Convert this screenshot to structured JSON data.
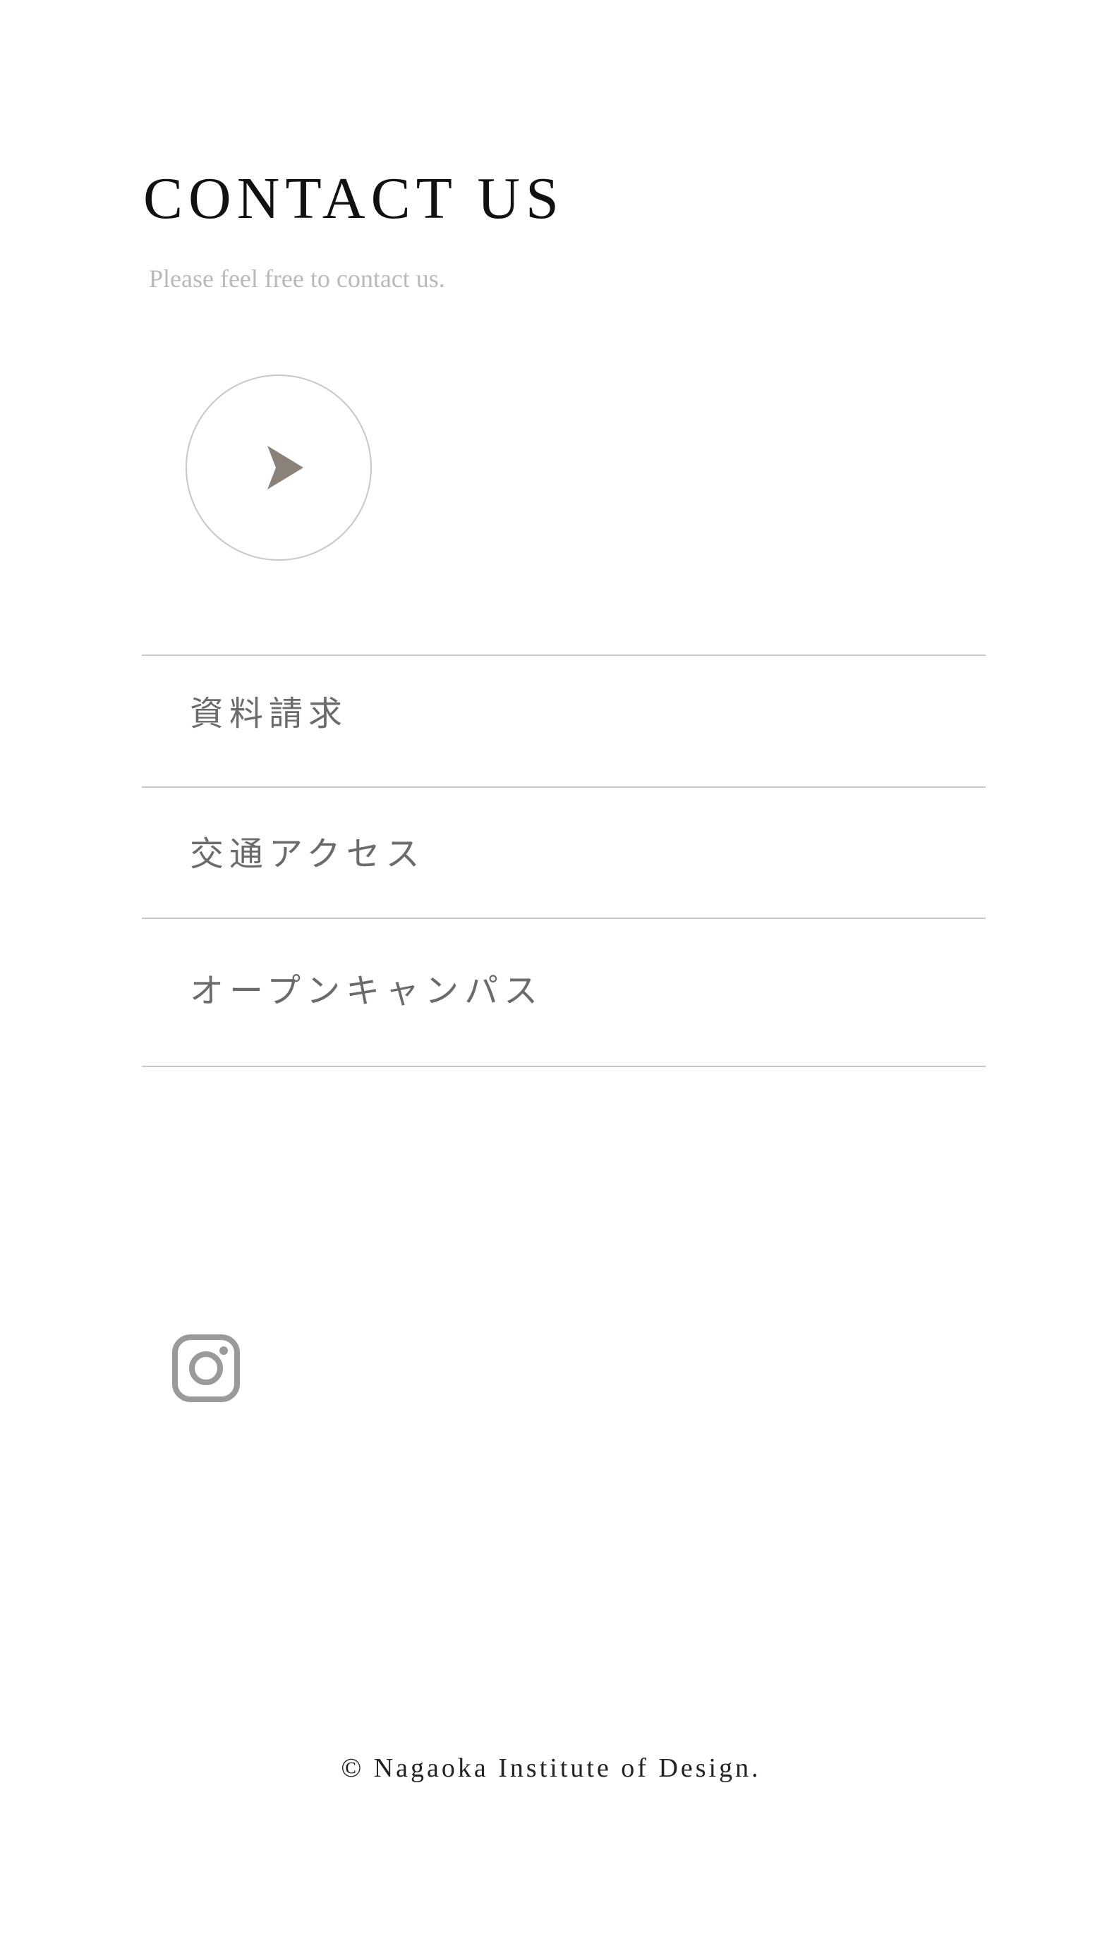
{
  "contact": {
    "title": "CONTACT US",
    "subtitle": "Please feel free to contact us.",
    "play_icon": "play-triangle-icon"
  },
  "menu": {
    "items": [
      {
        "label": "資料請求"
      },
      {
        "label": "交通アクセス"
      },
      {
        "label": "オープンキャンパス"
      }
    ]
  },
  "social": {
    "instagram_icon": "instagram-icon"
  },
  "footer": {
    "copyright": "© Nagaoka Institute of Design."
  },
  "colors": {
    "title": "#111111",
    "subtitle": "#b9b9b9",
    "menu_text": "#6b6b6b",
    "divider": "#c8c8c8",
    "play_arrow": "#8a8178",
    "instagram": "#9a9a9a"
  }
}
